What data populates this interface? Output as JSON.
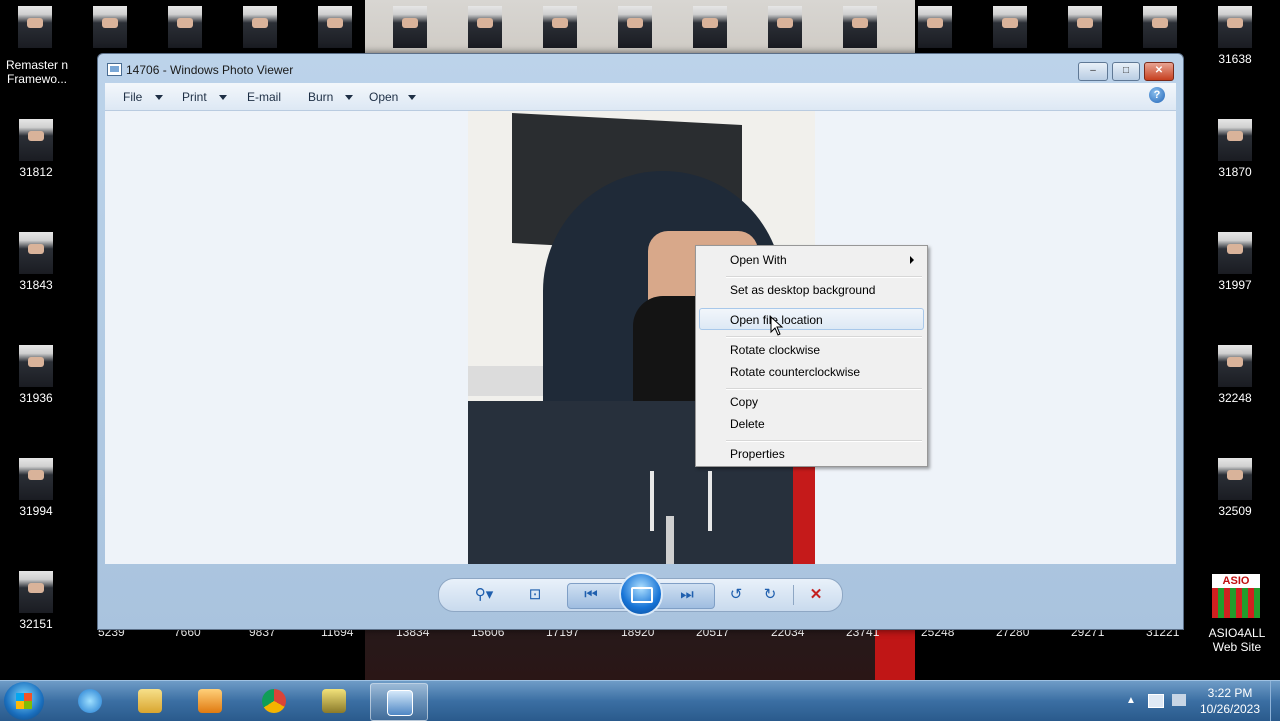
{
  "window": {
    "title": "14706 - Windows Photo Viewer",
    "minimize_label": "–",
    "maximize_label": "□",
    "close_label": "✕"
  },
  "menubar": {
    "items": [
      {
        "label": "File",
        "has_arrow": true
      },
      {
        "label": "Print",
        "has_arrow": true
      },
      {
        "label": "E-mail",
        "has_arrow": false
      },
      {
        "label": "Burn",
        "has_arrow": true
      },
      {
        "label": "Open",
        "has_arrow": true
      }
    ],
    "help_label": "?"
  },
  "context_menu": {
    "items": [
      {
        "label": "Open With",
        "submenu": true
      },
      {
        "label": "Set as desktop background"
      },
      {
        "label": "Open file location",
        "highlighted": true
      },
      {
        "label": "Rotate clockwise"
      },
      {
        "label": "Rotate counterclockwise"
      },
      {
        "label": "Copy"
      },
      {
        "label": "Delete"
      },
      {
        "label": "Properties"
      }
    ]
  },
  "controls": {
    "zoom_icon": "magnifier-icon",
    "actual_size_icon": "actual-size-icon",
    "previous_icon": "previous-icon",
    "slideshow_icon": "slideshow-icon",
    "next_icon": "next-icon",
    "rotate_ccw_icon": "rotate-ccw-icon",
    "rotate_cw_icon": "rotate-cw-icon",
    "delete_icon": "delete-icon"
  },
  "desktop": {
    "left_column": [
      {
        "label": "Remaster n Framewo..."
      },
      {
        "label": "31812"
      },
      {
        "label": "31843"
      },
      {
        "label": "31936"
      },
      {
        "label": "31994"
      },
      {
        "label": "32151"
      }
    ],
    "right_column": [
      {
        "label": "31638"
      },
      {
        "label": "31870"
      },
      {
        "label": "31997"
      },
      {
        "label": "32248"
      },
      {
        "label": "32509"
      }
    ],
    "bottom_row": [
      "5239",
      "7660",
      "9837",
      "11694",
      "13834",
      "15606",
      "17197",
      "18920",
      "20517",
      "22034",
      "23741",
      "25248",
      "27280",
      "29271",
      "31221"
    ],
    "asio_label": "ASIO4ALL Web Site",
    "asio_logo_text": "ASIO"
  },
  "taskbar": {
    "time": "3:22 PM",
    "date": "10/26/2023"
  }
}
